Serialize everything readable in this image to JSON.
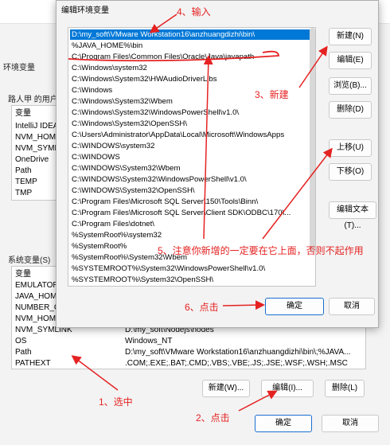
{
  "background_dialog": {
    "env_vars_label": "环境变量",
    "user_vars_label": "路人甲 的用户",
    "user_vars_header": "变量",
    "user_vars": [
      "IntelliJ IDEA",
      "NVM_HOME",
      "NVM_SYMLINK",
      "OneDrive",
      "Path",
      "TEMP",
      "TMP"
    ],
    "system_vars_label": "系统变量(S)",
    "system_vars_header": "变量",
    "system_vars": [
      {
        "name": "EMULATOR_",
        "value": ""
      },
      {
        "name": "JAVA_HOM",
        "value": ""
      },
      {
        "name": "NUMBER_O",
        "value": ""
      },
      {
        "name": "NVM_HOM",
        "value": ""
      },
      {
        "name": "NVM_SYMLINK",
        "value": "D:\\my_soft\\Nodejs\\nodes"
      },
      {
        "name": "OS",
        "value": "Windows_NT"
      },
      {
        "name": "Path",
        "value": "D:\\my_soft\\VMware Workstation16\\anzhuangdizhi\\bin\\;%JAVA..."
      },
      {
        "name": "PATHEXT",
        "value": ".COM;.EXE;.BAT;.CMD;.VBS;.VBE;.JS;.JSE;.WSF;.WSH;.MSC"
      }
    ],
    "buttons": {
      "new": "新建(W)...",
      "edit": "编辑(I)...",
      "delete": "删除(L)",
      "ok": "确定",
      "cancel": "取消"
    }
  },
  "edit_dialog": {
    "title": "编辑环境变量",
    "paths": [
      "D:\\my_soft\\VMware Workstation16\\anzhuangdizhi\\bin\\",
      "%JAVA_HOME%\\bin",
      "C:\\Program Files\\Common Files\\Oracle\\Java\\javapath",
      "C:\\Windows\\system32",
      "C:\\Windows\\System32\\HWAudioDriverLibs",
      "C:\\Windows",
      "C:\\Windows\\System32\\Wbem",
      "C:\\Windows\\System32\\WindowsPowerShell\\v1.0\\",
      "C:\\Windows\\System32\\OpenSSH\\",
      "C:\\Users\\Administrator\\AppData\\Local\\Microsoft\\WindowsApps",
      "C:\\WINDOWS\\system32",
      "C:\\WINDOWS",
      "C:\\WINDOWS\\System32\\Wbem",
      "C:\\WINDOWS\\System32\\WindowsPowerShell\\v1.0\\",
      "C:\\WINDOWS\\System32\\OpenSSH\\",
      "C:\\Program Files\\Microsoft SQL Server\\150\\Tools\\Binn\\",
      "C:\\Program Files\\Microsoft SQL Server\\Client SDK\\ODBC\\170\\...",
      "C:\\Program Files\\dotnet\\",
      "%SystemRoot%\\system32",
      "%SystemRoot%",
      "%SystemRoot%\\System32\\Wbem",
      "%SYSTEMROOT%\\System32\\WindowsPowerShell\\v1.0\\",
      "%SYSTEMROOT%\\System32\\OpenSSH\\"
    ],
    "selected_index": 0,
    "buttons": {
      "new": "新建(N)",
      "edit": "编辑(E)",
      "browse": "浏览(B)...",
      "delete": "删除(D)",
      "move_up": "上移(U)",
      "move_down": "下移(O)",
      "edit_text": "编辑文本(T)...",
      "ok": "确定",
      "cancel": "取消"
    }
  },
  "annotations": {
    "step1": "1、选中",
    "step2": "2、点击",
    "step3": "3、新建",
    "step4": "4、输入",
    "step5": "5、注意你新增的一定要在它上面，否则不起作用",
    "step6": "6、点击",
    "color": "#e52222"
  }
}
